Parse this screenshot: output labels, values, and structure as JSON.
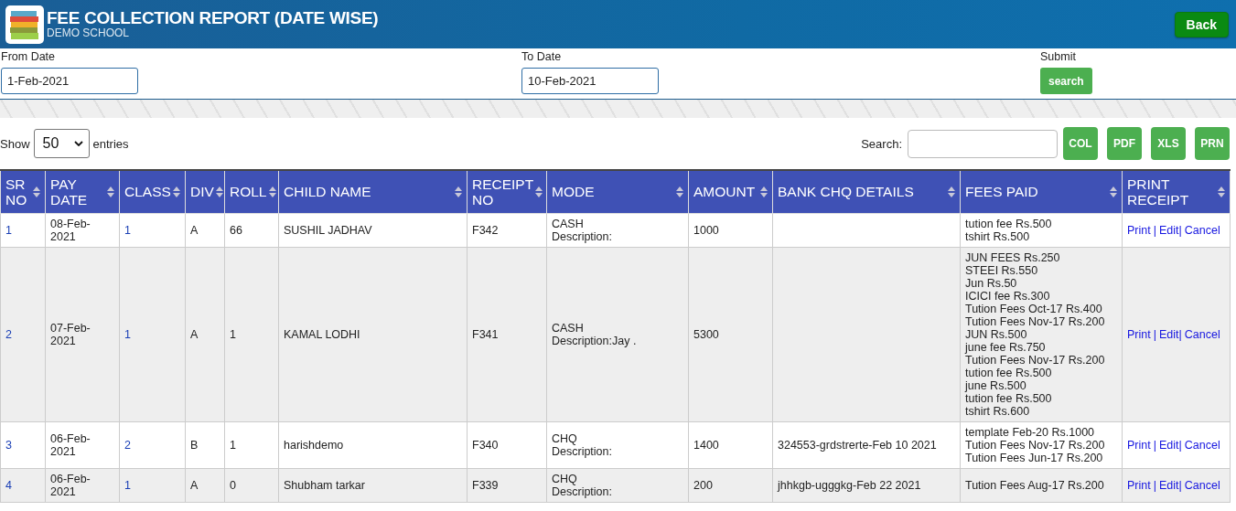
{
  "header": {
    "title": "FEE COLLECTION REPORT (DATE WISE)",
    "subtitle": "DEMO SCHOOL",
    "back_button": "Back"
  },
  "filters": [
    {
      "kind": "field",
      "label": "From Date",
      "value": "1-Feb-2021"
    },
    {
      "kind": "field",
      "label": "To Date",
      "value": "10-Feb-2021"
    },
    {
      "kind": "button",
      "label": "Submit",
      "button": "search"
    }
  ],
  "table_controls": {
    "show_label": "Show",
    "entries_value": "50",
    "entries_label": "entries",
    "search_label": "Search:",
    "export_buttons": [
      "COL",
      "PDF",
      "XLS",
      "PRN"
    ]
  },
  "table": {
    "columns": [
      "SR NO",
      "PAY DATE",
      "CLASS",
      "DIV",
      "ROLL",
      "CHILD NAME",
      "RECEIPT NO",
      "MODE",
      "AMOUNT",
      "BANK CHQ DETAILS",
      "FEES PAID",
      "PRINT RECEIPT"
    ],
    "rows": [
      {
        "sr_no": "1",
        "pay_date": "08-Feb-2021",
        "class": "1",
        "div": "A",
        "roll": "66",
        "child_name": "SUSHIL JADHAV",
        "receipt_no": "F342",
        "mode": "CASH",
        "description": "Description:",
        "amount": "1000",
        "bank_chq_details": "",
        "fees_paid": [
          "tution fee Rs.500",
          "tshirt Rs.500"
        ],
        "actions": [
          {
            "kind": "link",
            "label": "Print"
          },
          {
            "kind": "separator",
            "label": "|"
          },
          {
            "kind": "link",
            "label": "Edit"
          },
          {
            "kind": "separator",
            "label": "|"
          },
          {
            "kind": "link",
            "label": "Cancel"
          }
        ]
      },
      {
        "sr_no": "2",
        "pay_date": "07-Feb-2021",
        "class": "1",
        "div": "A",
        "roll": "1",
        "child_name": "KAMAL LODHI",
        "receipt_no": "F341",
        "mode": "CASH",
        "description": "Description:Jay .",
        "amount": "5300",
        "bank_chq_details": "",
        "fees_paid": [
          "JUN FEES Rs.250",
          "STEEI Rs.550",
          "Jun Rs.50",
          "ICICI fee Rs.300",
          "Tution Fees Oct-17 Rs.400",
          "Tution Fees Nov-17 Rs.200",
          "JUN Rs.500",
          "june fee Rs.750",
          "Tution Fees Nov-17 Rs.200",
          "tution fee Rs.500",
          "june Rs.500",
          "tution fee Rs.500",
          "tshirt Rs.600"
        ],
        "actions": [
          {
            "kind": "link",
            "label": "Print"
          },
          {
            "kind": "separator",
            "label": "|"
          },
          {
            "kind": "link",
            "label": "Edit"
          },
          {
            "kind": "separator",
            "label": "|"
          },
          {
            "kind": "link",
            "label": "Cancel"
          }
        ]
      },
      {
        "sr_no": "3",
        "pay_date": "06-Feb-2021",
        "class": "2",
        "div": "B",
        "roll": "1",
        "child_name": "harishdemo",
        "receipt_no": "F340",
        "mode": "CHQ",
        "description": "Description:",
        "amount": "1400",
        "bank_chq_details": "324553-grdstrerte-Feb 10 2021",
        "fees_paid": [
          "template Feb-20 Rs.1000",
          "Tution Fees Nov-17 Rs.200",
          "Tution Fees Jun-17 Rs.200"
        ],
        "actions": [
          {
            "kind": "link",
            "label": "Print"
          },
          {
            "kind": "separator",
            "label": "|"
          },
          {
            "kind": "link",
            "label": "Edit"
          },
          {
            "kind": "separator",
            "label": "|"
          },
          {
            "kind": "link",
            "label": "Cancel"
          }
        ]
      },
      {
        "sr_no": "4",
        "pay_date": "06-Feb-2021",
        "class": "1",
        "div": "A",
        "roll": "0",
        "child_name": "Shubham tarkar",
        "receipt_no": "F339",
        "mode": "CHQ",
        "description": "Description:",
        "amount": "200",
        "bank_chq_details": "jhhkgb-ugggkg-Feb 22 2021",
        "fees_paid": [
          "Tution Fees Aug-17 Rs.200"
        ],
        "actions": [
          {
            "kind": "link",
            "label": "Print"
          },
          {
            "kind": "separator",
            "label": "|"
          },
          {
            "kind": "link",
            "label": "Edit"
          },
          {
            "kind": "separator",
            "label": "|"
          },
          {
            "kind": "link",
            "label": "Cancel"
          }
        ]
      }
    ]
  }
}
